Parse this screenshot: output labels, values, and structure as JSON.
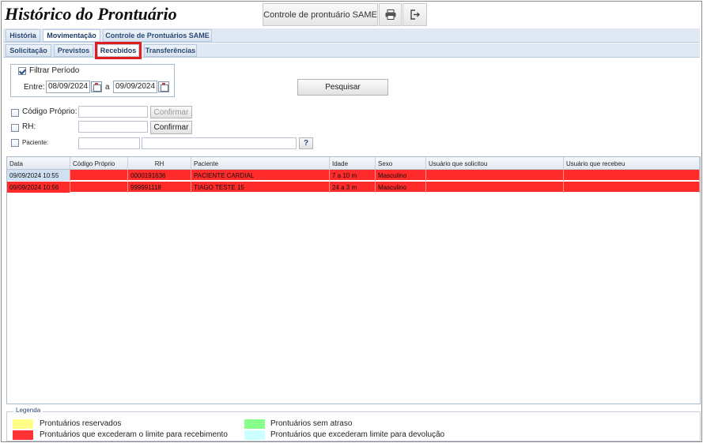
{
  "header": {
    "title": "Histórico do Prontuário",
    "same_button": "Controle de prontuário SAME",
    "print_icon": "printer-icon",
    "exit_icon": "exit-icon"
  },
  "tabs_main": [
    {
      "label": "História",
      "active": false
    },
    {
      "label": "Movimentação",
      "active": true
    },
    {
      "label": "Controle de Prontuários SAME",
      "active": false
    }
  ],
  "tabs_sub": [
    {
      "label": "Solicitação",
      "active": false
    },
    {
      "label": "Previstos",
      "active": false
    },
    {
      "label": "Recebidos",
      "active": true
    },
    {
      "label": "Transferências",
      "active": false
    }
  ],
  "filter": {
    "period_label": "Filtrar Período",
    "period_checked": true,
    "between_label": "Entre:",
    "date_from": "08/09/2024",
    "and_label": "a",
    "date_to": "09/09/2024",
    "search_button": "Pesquisar",
    "codigo_label": "Código Próprio:",
    "codigo_value": "",
    "codigo_confirm": "Confirmar",
    "rh_label": "RH:",
    "rh_value": "",
    "rh_confirm": "Confirmar",
    "paciente_label": "Paciente:",
    "paciente_code": "",
    "paciente_name": "",
    "help_label": "?"
  },
  "grid": {
    "columns": [
      "Data",
      "Código Próprio",
      "RH",
      "Paciente",
      "Idade",
      "Sexo",
      "Usuário que solicitou",
      "Usuário que recebeu"
    ],
    "rows": [
      [
        "09/09/2024 10:55",
        "",
        "0000191636",
        "PACIENTE CARDIAL",
        "7 a 10 m",
        "Masculino",
        "",
        ""
      ],
      [
        "09/09/2024 10:56",
        "",
        "999991118",
        "TIAGO TESTE 15",
        "24 a 3 m",
        "Masculino",
        "",
        ""
      ]
    ]
  },
  "legend": {
    "title": "Legenda",
    "items": [
      {
        "label": "Prontuários reservados",
        "color": "#ffff88"
      },
      {
        "label": "Prontuários sem atraso",
        "color": "#88ff88"
      },
      {
        "label": "Prontuários que excederam o limite para recebimento",
        "color": "#ff3333"
      },
      {
        "label": "Prontuários que excederam limite para devolução",
        "color": "#ccffff"
      }
    ]
  },
  "colors": {
    "overdue_row": "#ff2a2a",
    "selected_date": "#cfe0f3",
    "tab_highlight": "#e11d1d"
  }
}
